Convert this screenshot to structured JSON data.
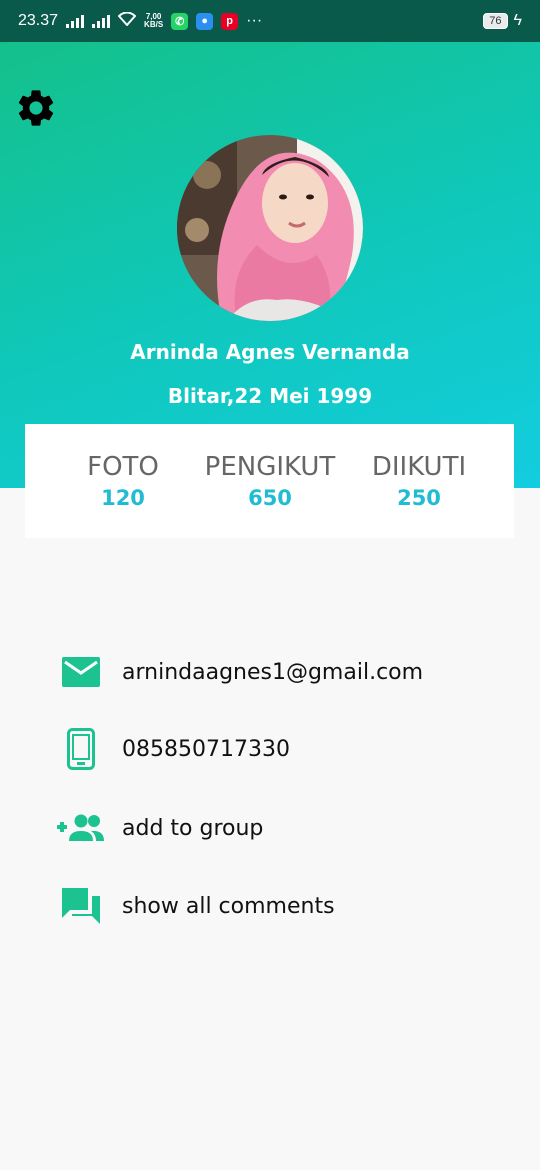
{
  "status_bar": {
    "time": "23.37",
    "speed_value": "7,00",
    "speed_unit": "KB/S",
    "more": "···",
    "battery": "76"
  },
  "profile": {
    "name": "Arninda Agnes Vernanda",
    "birth": "Blitar,22 Mei 1999"
  },
  "stats": [
    {
      "label": "FOTO",
      "value": "120"
    },
    {
      "label": "PENGIKUT",
      "value": "650"
    },
    {
      "label": "DIIKUTI",
      "value": "250"
    }
  ],
  "info": {
    "email": "arnindaagnes1@gmail.com",
    "phone": "085850717330",
    "group": "add to group",
    "comments": "show all comments"
  },
  "colors": {
    "accent": "#1cc28f",
    "stat_value": "#1fbcd2",
    "status_bar": "#0a5a4c"
  }
}
